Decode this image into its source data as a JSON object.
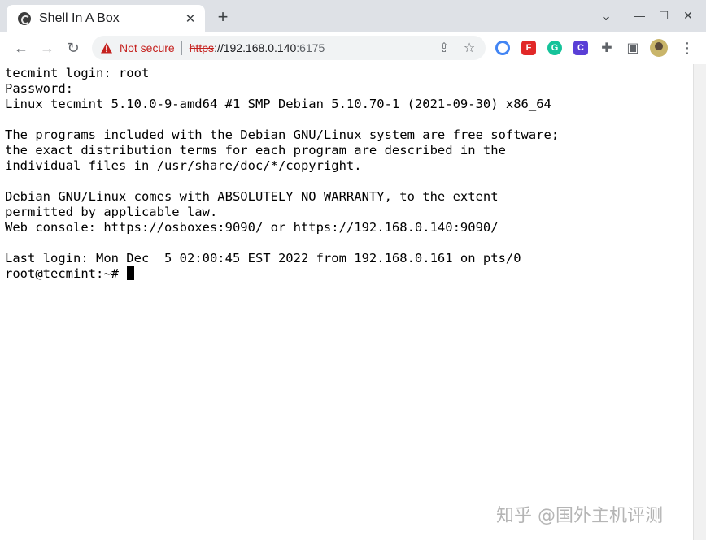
{
  "tab": {
    "title": "Shell In A Box",
    "close_symbol": "✕",
    "new_tab_symbol": "+"
  },
  "window_controls": {
    "dropdown": "⌄",
    "minimize": "—",
    "maximize": "☐",
    "close": "✕"
  },
  "toolbar": {
    "back": "←",
    "forward": "→",
    "reload": "↻",
    "security_label": "Not secure",
    "url_scheme": "https",
    "url_host": "://192.168.0.140",
    "url_port": ":6175",
    "share": "⇪",
    "bookmark": "☆",
    "extensions_puzzle": "✚",
    "sidebar": "▣",
    "menu": "⋮"
  },
  "extensions": [
    {
      "name": "chrome-color-icon",
      "color": "#4285f4",
      "glyph": "◉"
    },
    {
      "name": "flipboard-icon",
      "color": "#e12828",
      "glyph": "F"
    },
    {
      "name": "grammarly-icon",
      "color": "#15c39a",
      "glyph": "G"
    },
    {
      "name": "extension-c-icon",
      "color": "#5a3fd6",
      "glyph": "C"
    }
  ],
  "terminal": {
    "lines": [
      "tecmint login: root",
      "Password:",
      "Linux tecmint 5.10.0-9-amd64 #1 SMP Debian 5.10.70-1 (2021-09-30) x86_64",
      "",
      "The programs included with the Debian GNU/Linux system are free software;",
      "the exact distribution terms for each program are described in the",
      "individual files in /usr/share/doc/*/copyright.",
      "",
      "Debian GNU/Linux comes with ABSOLUTELY NO WARRANTY, to the extent",
      "permitted by applicable law.",
      "Web console: https://osboxes:9090/ or https://192.168.0.140:9090/",
      "",
      "Last login: Mon Dec  5 02:00:45 EST 2022 from 192.168.0.161 on pts/0"
    ],
    "prompt": "root@tecmint:~# "
  },
  "watermark": "知乎 @国外主机评测"
}
